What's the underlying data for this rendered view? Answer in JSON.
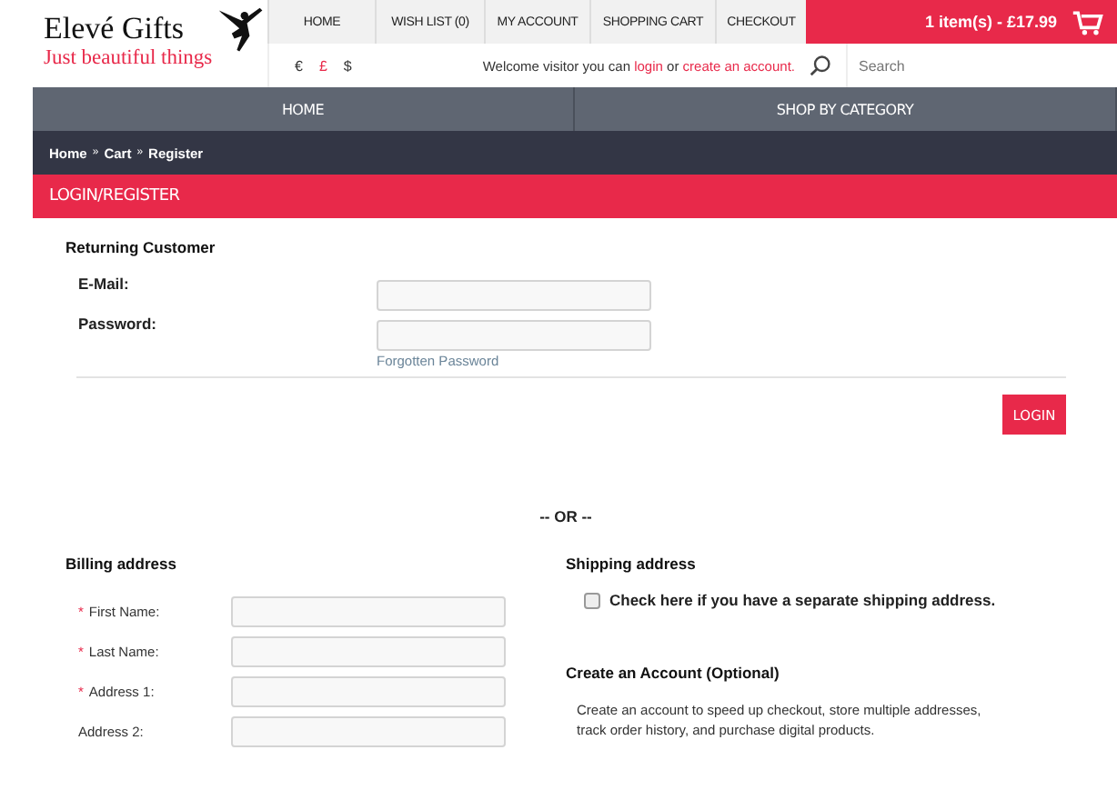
{
  "logo": {
    "name": "Elevé Gifts",
    "tagline": "Just beautiful things"
  },
  "top_nav": [
    "HOME",
    "WISH LIST (0)",
    "MY ACCOUNT",
    "SHOPPING CART",
    "CHECKOUT"
  ],
  "cart": {
    "label": "1 item(s) - £17.99"
  },
  "currencies": [
    {
      "symbol": "€",
      "selected": false
    },
    {
      "symbol": "£",
      "selected": true
    },
    {
      "symbol": "$",
      "selected": false
    }
  ],
  "welcome": {
    "prefix": "Welcome visitor you can",
    "login_link": "login",
    "middle": "or",
    "create_link": "create an account."
  },
  "search": {
    "placeholder": "Search"
  },
  "main_nav": [
    "HOME",
    "SHOP BY CATEGORY"
  ],
  "breadcrumb": [
    "Home",
    "»",
    "Cart",
    "»",
    "Register"
  ],
  "page_title": "LOGIN/REGISTER",
  "returning": {
    "heading": "Returning Customer",
    "fields": [
      {
        "label": "E-Mail:"
      },
      {
        "label": "Password:"
      }
    ],
    "forgot_link": "Forgotten Password",
    "login_button": "LOGIN"
  },
  "separator": "-- OR --",
  "billing": {
    "heading": "Billing address",
    "fields": [
      {
        "label": "First Name:",
        "required_mark": "*"
      },
      {
        "label": "Last Name:",
        "required_mark": "*"
      },
      {
        "label": "Address 1:",
        "required_mark": "*"
      },
      {
        "label": "Address 2:"
      }
    ]
  },
  "shipping": {
    "heading": "Shipping address",
    "checkbox": {
      "label": "Check here if you have a separate shipping address.",
      "checked": false
    }
  },
  "account": {
    "heading": "Create an Account (Optional)",
    "text": "Create an account to speed up checkout, store multiple addresses, track order history, and purchase digital products."
  }
}
